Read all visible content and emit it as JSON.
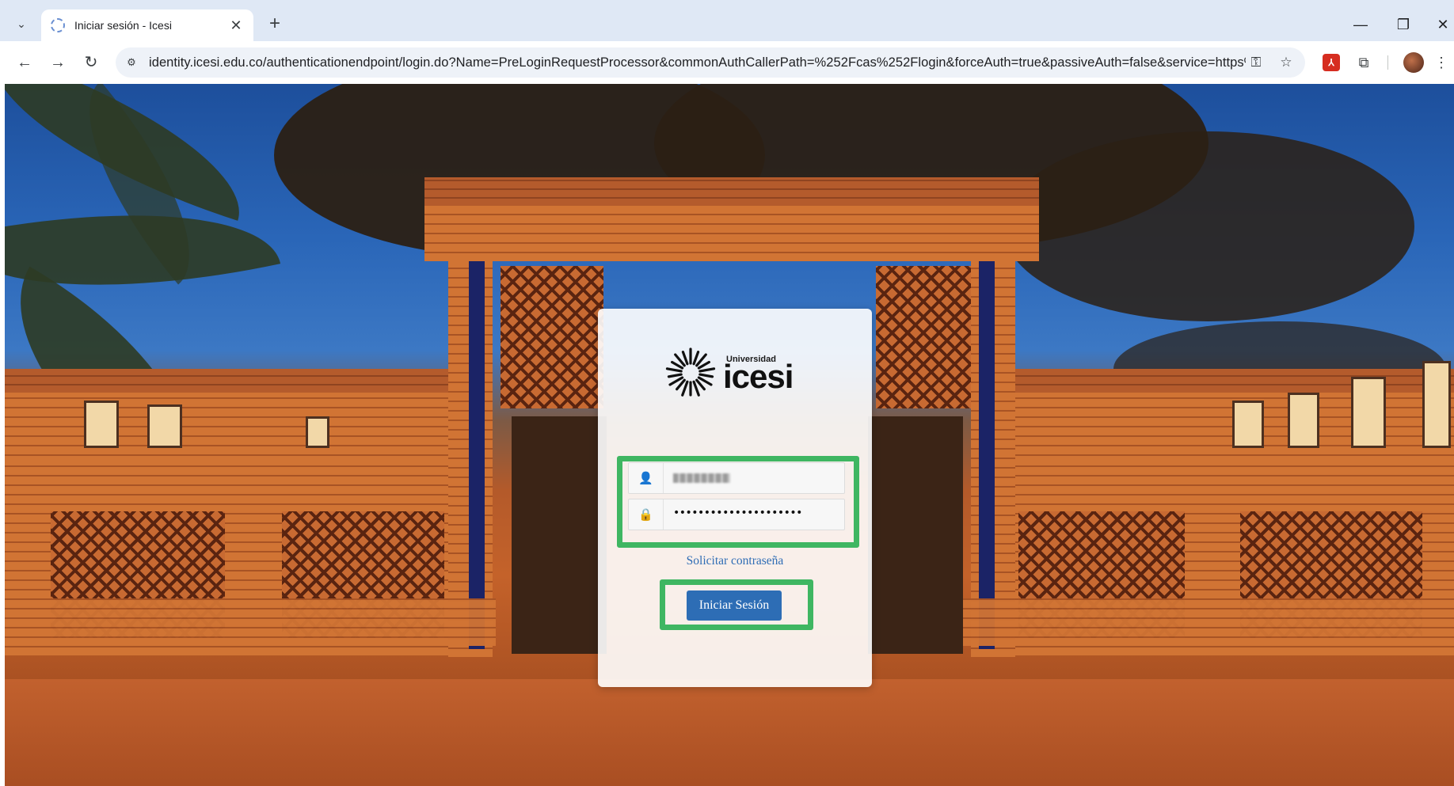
{
  "browser": {
    "tab_title": "Iniciar sesión - Icesi",
    "url": "identity.icesi.edu.co/authenticationendpoint/login.do?Name=PreLoginRequestProcessor&commonAuthCallerPath=%252Fcas%252Flogin&forceAuth=true&passiveAuth=false&service=https%...",
    "icons": {
      "tab_search": "chevron-down-icon",
      "new_tab": "plus-icon",
      "back": "arrow-left-icon",
      "forward": "arrow-right-icon",
      "reload": "reload-icon",
      "site_info": "tune-icon",
      "password_manager": "key-icon",
      "bookmark": "star-icon",
      "pdf_extension": "acrobat-icon",
      "extensions": "puzzle-icon",
      "menu": "kebab-menu-icon"
    },
    "glyphs": {
      "tab_search": "⌄",
      "tab_close": "✕",
      "new_tab": "+",
      "minimize": "—",
      "restore": "❐",
      "close": "✕",
      "back": "←",
      "forward": "→",
      "reload": "↻",
      "site_info": "⚙",
      "password_key": "⚿",
      "bookmark": "☆",
      "pdf": "⅄",
      "extensions": "⧉",
      "menu": "⋮"
    }
  },
  "login": {
    "logo_small_text": "Universidad",
    "logo_name": "icesi",
    "username_icon": "user-icon",
    "password_icon": "lock-icon",
    "user_glyph": "👤",
    "lock_glyph": "🔒",
    "password_mask": "•••••••••••••••••••••",
    "forgot_password_link": "Solicitar contraseña",
    "submit_label": "Iniciar Sesión",
    "highlight_color": "#3fb662",
    "button_color": "#2d6db5"
  }
}
